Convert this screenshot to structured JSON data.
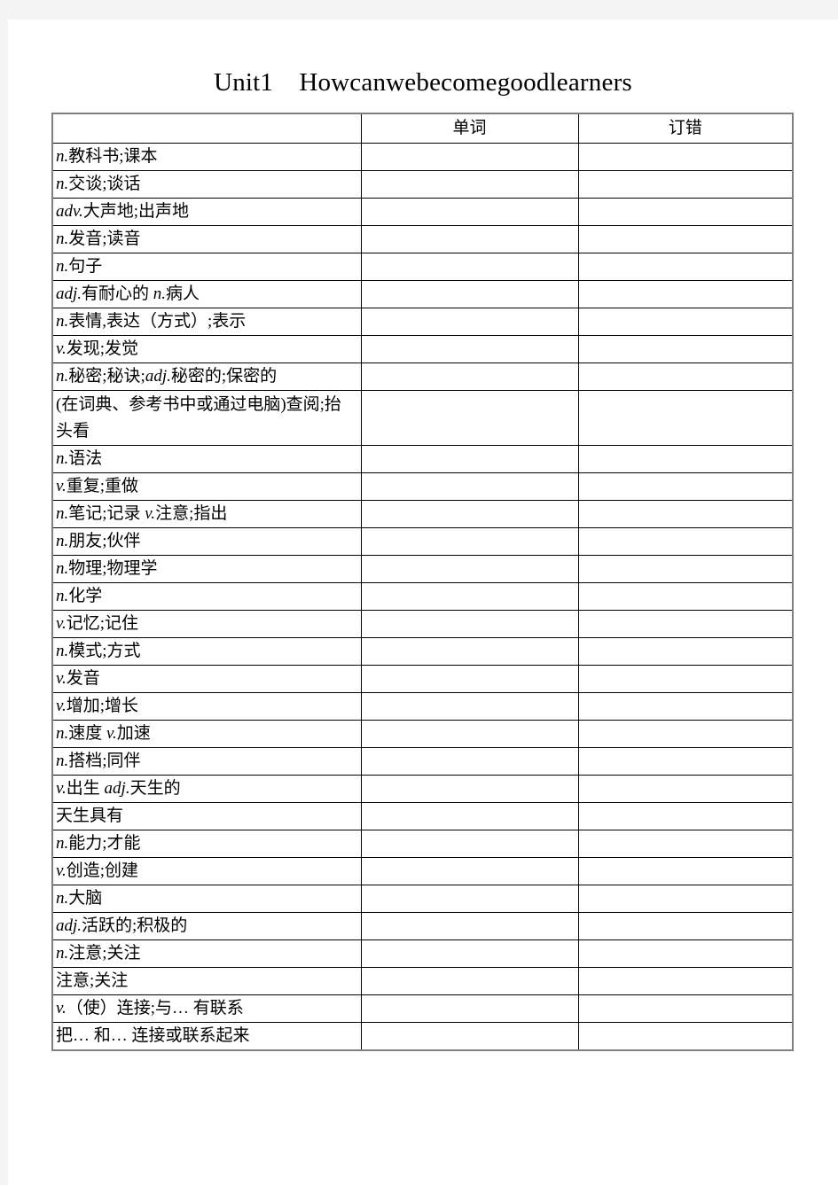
{
  "document": {
    "title": "Unit1　Howcanwebecomegoodlearners"
  },
  "table": {
    "headers": {
      "meaning": "",
      "word": "单词",
      "correction": "订错"
    },
    "rows": [
      {
        "pos": "n.",
        "meaning": "教科书;课本",
        "word": "",
        "correction": ""
      },
      {
        "pos": "n.",
        "meaning": "交谈;谈话",
        "word": "",
        "correction": ""
      },
      {
        "pos": "adv.",
        "meaning": "大声地;出声地",
        "word": "",
        "correction": ""
      },
      {
        "pos": "n.",
        "meaning": "发音;读音",
        "word": "",
        "correction": ""
      },
      {
        "pos": "n.",
        "meaning": "句子",
        "word": "",
        "correction": ""
      },
      {
        "pos": "adj.",
        "meaning": "有耐心的 <i>n.</i>病人",
        "word": "",
        "correction": ""
      },
      {
        "pos": "n.",
        "meaning": "表情,表达（方式）;表示",
        "word": "",
        "correction": ""
      },
      {
        "pos": "v.",
        "meaning": "发现;发觉",
        "word": "",
        "correction": ""
      },
      {
        "pos": "n.",
        "meaning": "秘密;秘诀;<i>adj.</i>秘密的;保密的",
        "word": "",
        "correction": ""
      },
      {
        "pos": "",
        "meaning": "(在词典、参考书中或通过电脑)查阅;抬头看",
        "word": "",
        "correction": "",
        "tall": true
      },
      {
        "pos": "n.",
        "meaning": "语法",
        "word": "",
        "correction": ""
      },
      {
        "pos": "v.",
        "meaning": "重复;重做",
        "word": "",
        "correction": ""
      },
      {
        "pos": "n.",
        "meaning": "笔记;记录 <i>v.</i>注意;指出",
        "word": "",
        "correction": ""
      },
      {
        "pos": "n.",
        "meaning": "朋友;伙伴",
        "word": "",
        "correction": ""
      },
      {
        "pos": "n.",
        "meaning": "物理;物理学",
        "word": "",
        "correction": ""
      },
      {
        "pos": "n.",
        "meaning": "化学",
        "word": "",
        "correction": ""
      },
      {
        "pos": "v.",
        "meaning": "记忆;记住",
        "word": "",
        "correction": ""
      },
      {
        "pos": "n.",
        "meaning": "模式;方式",
        "word": "",
        "correction": ""
      },
      {
        "pos": "v.",
        "meaning": "发音",
        "word": "",
        "correction": ""
      },
      {
        "pos": "v.",
        "meaning": "增加;增长",
        "word": "",
        "correction": ""
      },
      {
        "pos": "n.",
        "meaning": "速度 <i>v.</i>加速",
        "word": "",
        "correction": ""
      },
      {
        "pos": "n.",
        "meaning": "搭档;同伴",
        "word": "",
        "correction": ""
      },
      {
        "pos": "v.",
        "meaning": "出生 <i>adj.</i>天生的",
        "word": "",
        "correction": ""
      },
      {
        "pos": "",
        "meaning": "天生具有",
        "word": "",
        "correction": ""
      },
      {
        "pos": "n.",
        "meaning": "能力;才能",
        "word": "",
        "correction": ""
      },
      {
        "pos": "v.",
        "meaning": "创造;创建",
        "word": "",
        "correction": ""
      },
      {
        "pos": "n.",
        "meaning": "大脑",
        "word": "",
        "correction": ""
      },
      {
        "pos": "adj.",
        "meaning": "活跃的;积极的",
        "word": "",
        "correction": ""
      },
      {
        "pos": "n.",
        "meaning": "注意;关注",
        "word": "",
        "correction": ""
      },
      {
        "pos": "",
        "meaning": "注意;关注",
        "word": "",
        "correction": ""
      },
      {
        "pos": "v.",
        "meaning": "（使）连接;与… 有联系",
        "word": "",
        "correction": ""
      },
      {
        "pos": "",
        "meaning": "把… 和… 连接或联系起来",
        "word": "",
        "correction": ""
      }
    ]
  }
}
